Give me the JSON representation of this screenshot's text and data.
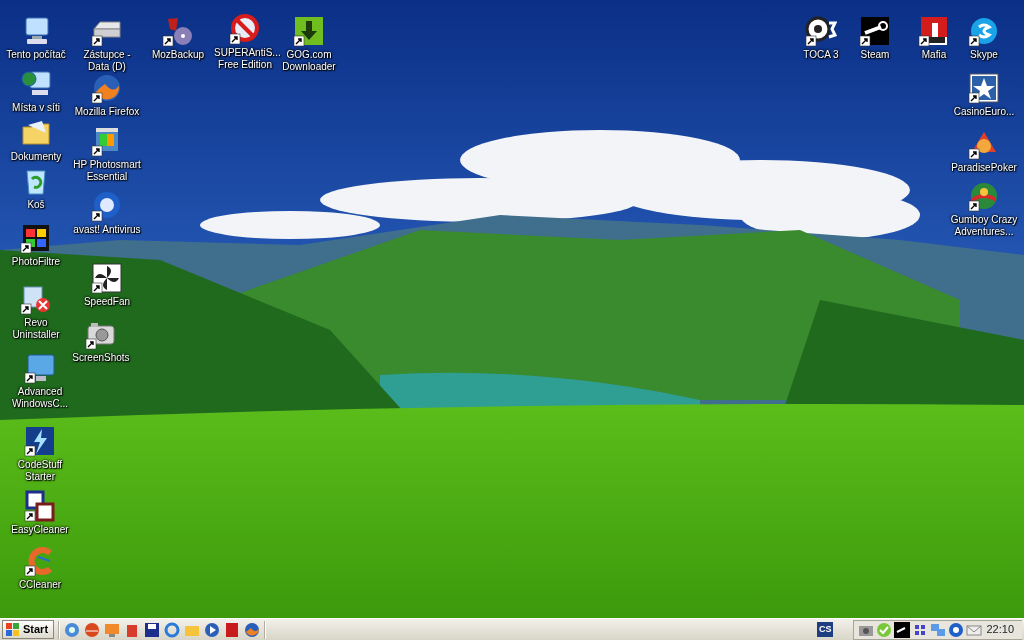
{
  "desktop_icons": [
    {
      "label": "Tento počítač",
      "shortcut": false
    },
    {
      "label": "Místa v síti",
      "shortcut": false
    },
    {
      "label": "Dokumenty",
      "shortcut": false
    },
    {
      "label": "Koš",
      "shortcut": false
    },
    {
      "label": "PhotoFiltre",
      "shortcut": true
    },
    {
      "label": "Revo Uninstaller",
      "shortcut": true
    },
    {
      "label": "Advanced WindowsC...",
      "shortcut": true
    },
    {
      "label": "CodeStuff Starter",
      "shortcut": true
    },
    {
      "label": "EasyCleaner",
      "shortcut": true
    },
    {
      "label": "CCleaner",
      "shortcut": true
    },
    {
      "label": "Zástupce - Data (D)",
      "shortcut": true
    },
    {
      "label": "Mozilla Firefox",
      "shortcut": true
    },
    {
      "label": "HP Photosmart Essential",
      "shortcut": true
    },
    {
      "label": "avast! Antivirus",
      "shortcut": true
    },
    {
      "label": "SpeedFan",
      "shortcut": true
    },
    {
      "label": "ScreenShots",
      "shortcut": true
    },
    {
      "label": "MozBackup",
      "shortcut": true
    },
    {
      "label": "SUPERAntiS... Free Edition",
      "shortcut": true
    },
    {
      "label": "GOG.com Downloader",
      "shortcut": true
    },
    {
      "label": "TOCA 3",
      "shortcut": true
    },
    {
      "label": "Steam",
      "shortcut": true
    },
    {
      "label": "Mafia",
      "shortcut": true
    },
    {
      "label": "Skype",
      "shortcut": true
    },
    {
      "label": "CasinoEuro...",
      "shortcut": true
    },
    {
      "label": "ParadisePoker",
      "shortcut": true
    },
    {
      "label": "Gumboy Crazy Adventures...",
      "shortcut": true
    }
  ],
  "taskbar": {
    "start_label": "Start",
    "task_icon_text": "CS",
    "clock": "22:10"
  }
}
